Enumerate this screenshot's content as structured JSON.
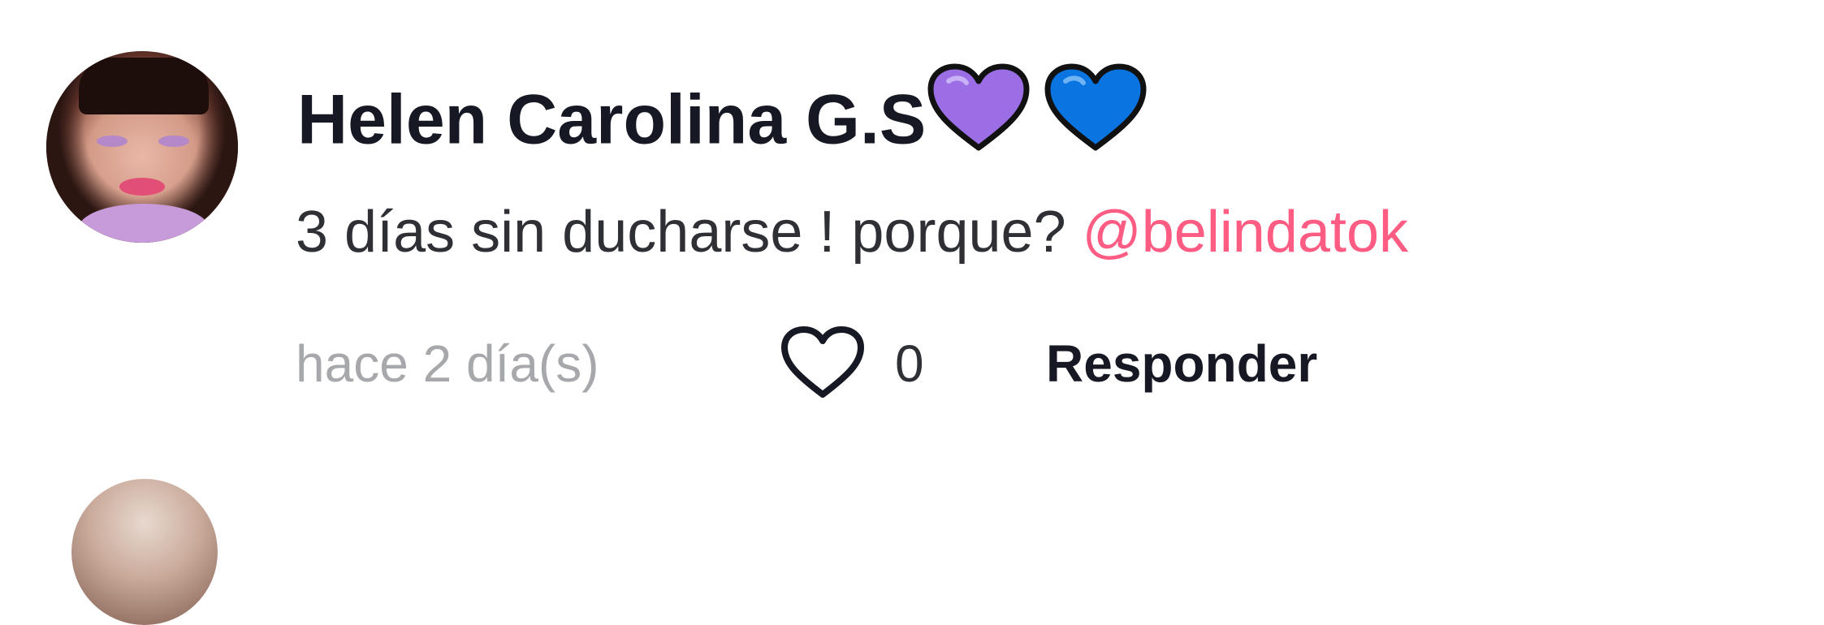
{
  "comment": {
    "username": "Helen Carolina G.S",
    "username_emojis": [
      "purple-heart",
      "blue-heart"
    ],
    "text": "3 días sin ducharse ! porque?",
    "mention": "@belindatok",
    "timestamp": "hace 2 día(s)",
    "like_count": "0",
    "reply_label": "Responder"
  },
  "colors": {
    "username": "#161823",
    "text": "#2f3035",
    "mention": "#fe5c82",
    "timestamp": "#a7a8ab",
    "purple_heart": "#9b6ee6",
    "blue_heart": "#0a74e0"
  }
}
